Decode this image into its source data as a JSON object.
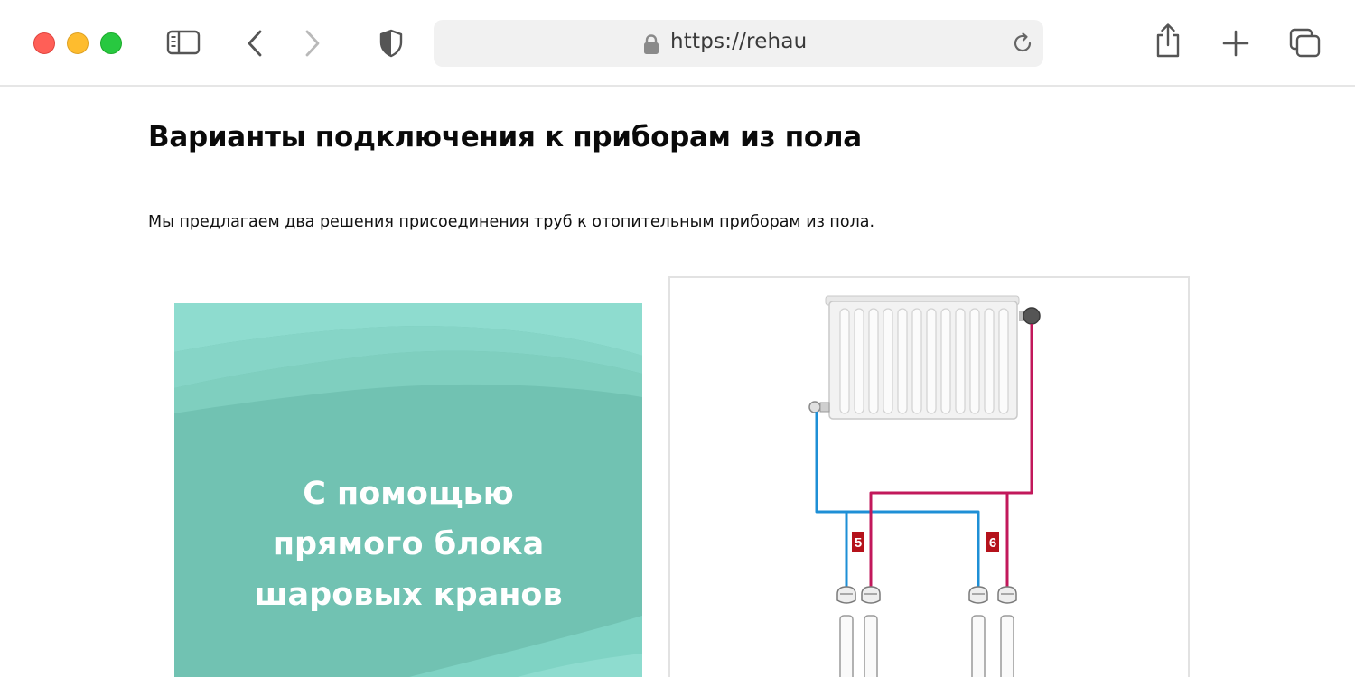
{
  "browser": {
    "url": "https://rehau",
    "icons": {
      "sidebar": "sidebar-icon",
      "back": "chevron-left-icon",
      "forward": "chevron-right-icon",
      "privacy": "shield-icon",
      "lock": "lock-icon",
      "reload": "reload-icon",
      "share": "share-icon",
      "new_tab": "plus-icon",
      "tabs": "tabs-overview-icon"
    }
  },
  "page": {
    "title": "Варианты подключения к приборам из пола",
    "intro": "Мы предлагаем два решения присоединения труб к отопительным приборам из пола."
  },
  "cards": {
    "ball_valve": {
      "caption": [
        "С помощью",
        "прямого блока",
        "шаровых кранов"
      ],
      "colors": {
        "base": "#71c2b2",
        "wave_light": "#8edccf",
        "wave_mid": "#7fcfbf",
        "text": "#ffffff"
      }
    },
    "diagram": {
      "labels": [
        "5",
        "6"
      ],
      "colors": {
        "supply": "#1e8fd6",
        "return": "#c2185b",
        "label_bg": "#b5121b"
      },
      "icons": [
        "radiator-icon",
        "thermostat-head-icon",
        "valve-icon",
        "fitting-icon"
      ]
    }
  },
  "colors": {
    "accent_red": "#ff5f57",
    "accent_yellow": "#febc2e",
    "accent_green": "#28c840",
    "address_bar_bg": "#f1f1f1"
  }
}
